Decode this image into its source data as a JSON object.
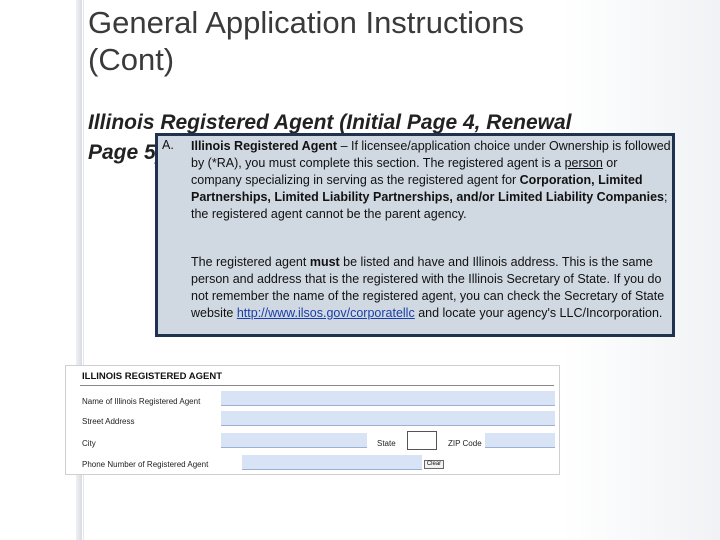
{
  "slide": {
    "title_line1": "General Application Instructions",
    "title_line2": "(Cont)",
    "subtitle_line1": "Illinois Registered Agent (Initial Page 4, Renewal",
    "subtitle_line2": "Page 5)"
  },
  "instructions": {
    "marker": "A.",
    "p1_heading": "Illinois Registered Agent",
    "p1_a": " – If licensee/application choice under Ownership is followed by (*RA), you must complete this section.  The registered agent is a ",
    "p1_person": "person",
    "p1_b": " or company specializing in serving as the registered agent for ",
    "p1_entities": "Corporation, Limited Partnerships, Limited Liability Partnerships, and/or Limited Liability Companies",
    "p1_c": "; the registered agent cannot be the parent agency.",
    "p2_a": "The registered agent ",
    "p2_must": "must",
    "p2_b": " be listed and have and Illinois address.  This is the same person and address that is the registered with the Illinois Secretary of State.  If you do not remember the name of the registered agent, you can check the Secretary of State website ",
    "p2_link": "http://www.ilsos.gov/corporatellc",
    "p2_c": " and locate your agency's LLC/Incorporation."
  },
  "form": {
    "title": "ILLINOIS REGISTERED AGENT",
    "name_label": "Name of Illinois Registered Agent",
    "street_label": "Street Address",
    "city_label": "City",
    "state_label": "State",
    "zip_label": "ZIP Code",
    "phone_label": "Phone Number of Registered Agent",
    "clear_button": "Clear"
  }
}
